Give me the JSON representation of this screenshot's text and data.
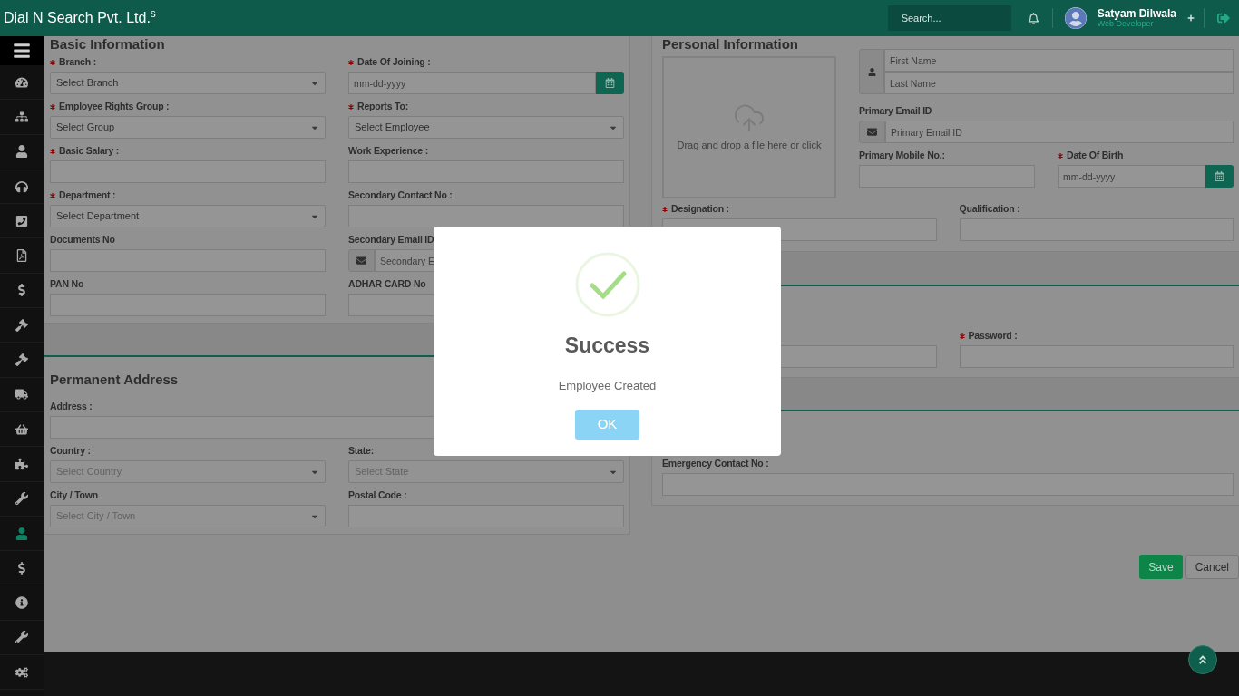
{
  "header": {
    "brand": "Dial N Search Pvt. Ltd.$^{s}$",
    "search": {
      "placeholder": "Search..."
    },
    "user": {
      "name": "Satyam Dilwala",
      "role": "Web Developer"
    }
  },
  "sidebar": {
    "items": [
      {
        "kind": "gauge",
        "selected": false
      },
      {
        "kind": "sitemap",
        "selected": false
      },
      {
        "kind": "user",
        "selected": false
      },
      {
        "kind": "headset",
        "selected": false
      },
      {
        "kind": "phone",
        "selected": false
      },
      {
        "kind": "pdf",
        "selected": false
      },
      {
        "kind": "dollar",
        "selected": false
      },
      {
        "kind": "gavel",
        "selected": false
      },
      {
        "kind": "gavel",
        "selected": false
      },
      {
        "kind": "truck",
        "selected": false
      },
      {
        "kind": "basket",
        "selected": false
      },
      {
        "kind": "puzzle",
        "selected": false
      },
      {
        "kind": "wrench",
        "selected": false
      },
      {
        "kind": "user",
        "selected": true
      },
      {
        "kind": "dollar",
        "selected": false
      },
      {
        "kind": "info",
        "selected": false
      },
      {
        "kind": "wrench",
        "selected": false
      },
      {
        "kind": "cogs",
        "selected": false
      }
    ]
  },
  "basic_information": {
    "title": "Basic Information",
    "fields": [
      {
        "label": "Branch :",
        "required": true,
        "kind": "select",
        "value": "Select Branch",
        "disabled": false
      },
      {
        "label": "Date Of Joining :",
        "required": true,
        "kind": "date",
        "placeholder": "mm-dd-yyyy"
      },
      {
        "label": "Employee Rights Group :",
        "required": true,
        "kind": "select",
        "value": "Select Group",
        "disabled": false
      },
      {
        "label": "Reports To:",
        "required": true,
        "kind": "select",
        "value": "Select Employee",
        "disabled": false
      },
      {
        "label": "Basic Salary :",
        "required": true,
        "kind": "text"
      },
      {
        "label": "Work Experience :",
        "required": false,
        "kind": "text"
      },
      {
        "label": "Department :",
        "required": true,
        "kind": "select",
        "value": "Select Department",
        "disabled": false
      },
      {
        "label": "Secondary Contact No :",
        "required": false,
        "kind": "text"
      },
      {
        "label": "Documents No",
        "required": false,
        "kind": "text"
      },
      {
        "label": "Secondary Email ID",
        "required": false,
        "kind": "email",
        "placeholder": "Secondary E"
      },
      {
        "label": "PAN No",
        "required": false,
        "kind": "text"
      },
      {
        "label": "ADHAR CARD No",
        "required": false,
        "kind": "text"
      }
    ]
  },
  "permanent_address": {
    "title": "Permanent Address",
    "fields": [
      {
        "label": "Address :",
        "required": false,
        "kind": "text",
        "full_width": true
      },
      {
        "label": "Country :",
        "required": false,
        "kind": "select",
        "placeholder": "Select Country",
        "disabled": true
      },
      {
        "label": "State:",
        "required": false,
        "kind": "select",
        "placeholder": "Select State",
        "disabled": true
      },
      {
        "label": "City / Town",
        "required": false,
        "kind": "select",
        "placeholder": "Select City / Town",
        "disabled": true
      },
      {
        "label": "Postal Code :",
        "required": false,
        "kind": "text"
      }
    ]
  },
  "personal_information": {
    "title": "Personal Information",
    "upload": {
      "text": "Drag and drop a file here or click"
    },
    "name": {
      "first_placeholder": "First Name",
      "last_placeholder": "Last Name"
    },
    "fields": [
      {
        "label": "Primary Email ID",
        "required": false,
        "kind": "email",
        "placeholder": "Primary Email ID",
        "full_width": true
      },
      {
        "label": "Primary Mobile No.:",
        "required": false,
        "kind": "text"
      },
      {
        "label": "Date Of Birth",
        "required": true,
        "kind": "date",
        "placeholder": "mm-dd-yyyy"
      }
    ],
    "lower_fields": [
      {
        "label": "Designation :",
        "required": true,
        "kind": "text"
      },
      {
        "label": "Qualification :",
        "required": false,
        "kind": "text"
      }
    ]
  },
  "account": {
    "fields": [
      {
        "kind": "text"
      },
      {
        "label": "Password :",
        "required": true,
        "kind": "text"
      }
    ]
  },
  "contact": {
    "fields": [
      {
        "label": "Emergency Contact No :",
        "required": false,
        "kind": "text",
        "full_width": true
      }
    ]
  },
  "actions": [
    {
      "label": "Save",
      "kind": "primary"
    },
    {
      "label": "Cancel",
      "kind": "secondary"
    }
  ],
  "dialog": {
    "title": "Success",
    "message": "Employee Created",
    "button": "OK"
  }
}
